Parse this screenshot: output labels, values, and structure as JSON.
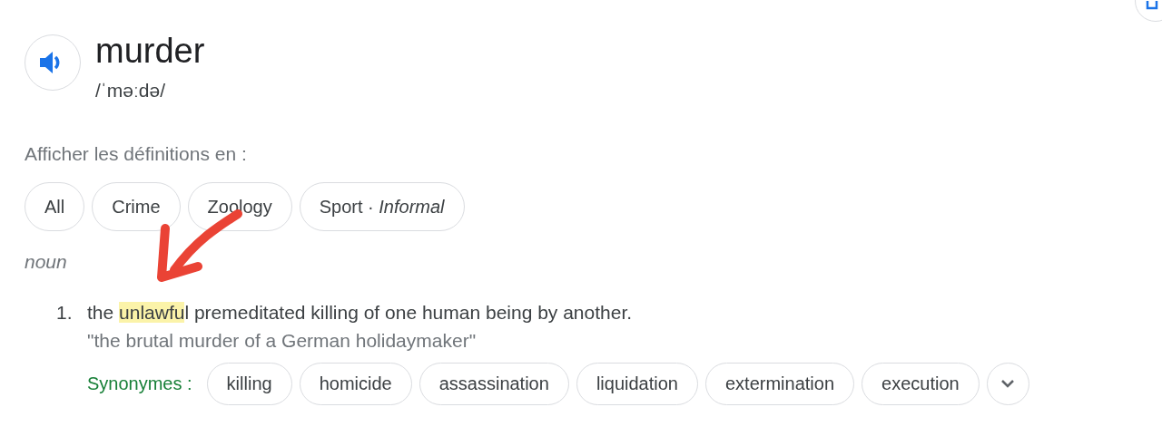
{
  "word": "murder",
  "pronunciation": "/ˈməːdə/",
  "definitions_label": "Afficher les définitions en :",
  "filters": [
    {
      "label": "All",
      "selected": false
    },
    {
      "label": "Crime",
      "selected": false
    },
    {
      "label": "Zoology",
      "selected": false
    },
    {
      "label": "Sport · *Informal*",
      "selected": false
    }
  ],
  "part_of_speech": "noun",
  "senses": [
    {
      "number": "1.",
      "definition": {
        "before": "the ",
        "highlighted": "unlawfu",
        "after": "l premeditated killing of one human being by another."
      },
      "example": "\"the brutal murder of a German holidaymaker\"",
      "synonyms_label": "Synonymes :",
      "synonyms": [
        "killing",
        "homicide",
        "assassination",
        "liquidation",
        "extermination",
        "execution"
      ]
    }
  ]
}
